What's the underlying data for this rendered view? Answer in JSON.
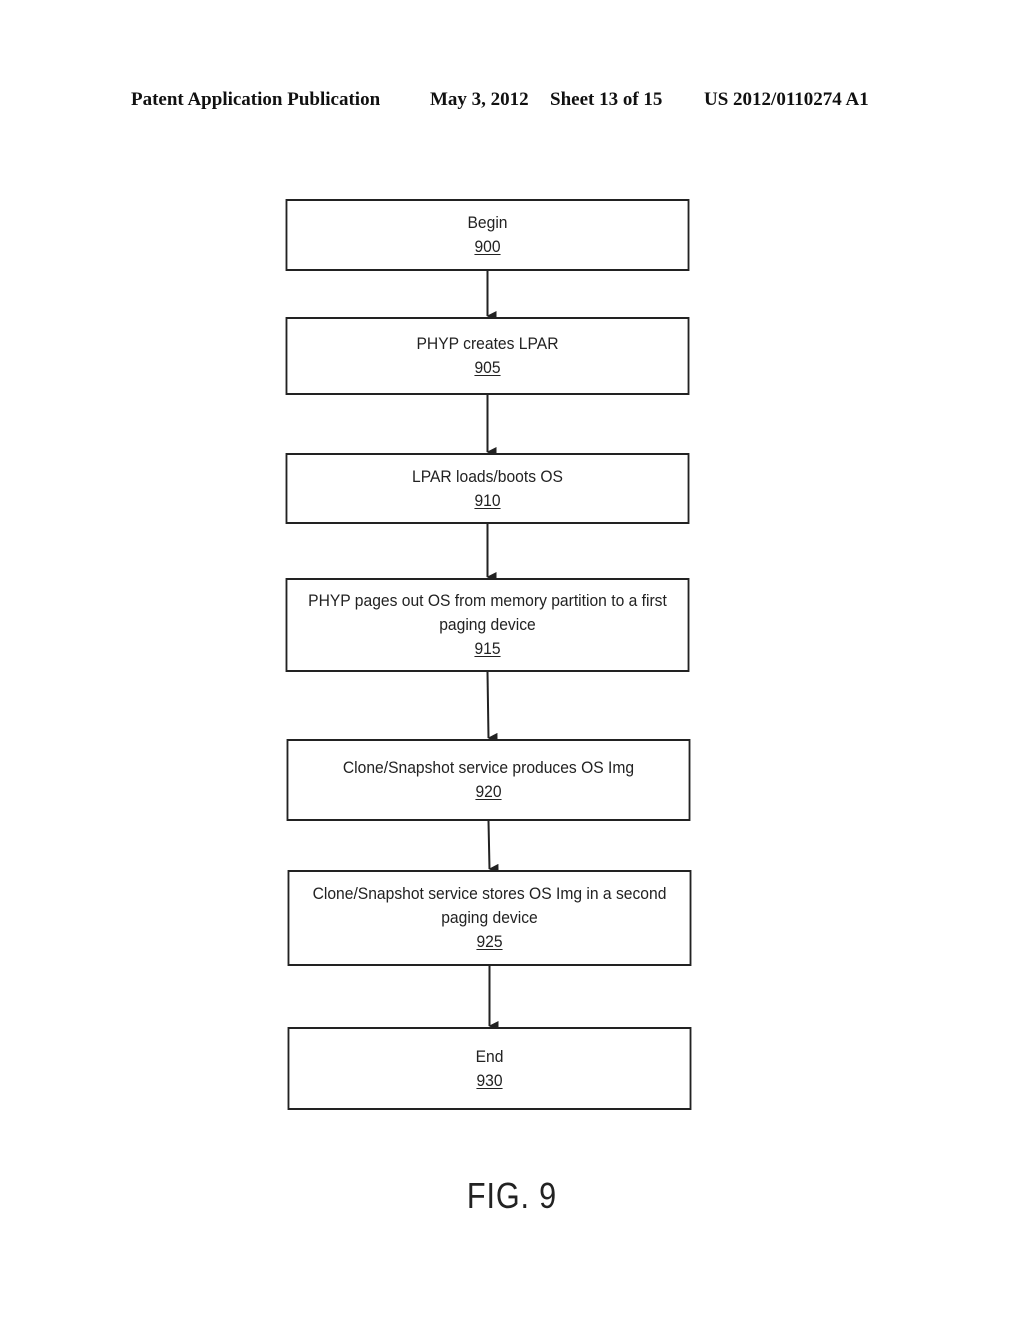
{
  "header": {
    "publication": "Patent Application Publication",
    "date": "May 3, 2012",
    "sheet": "Sheet 13 of 15",
    "number": "US 2012/0110274 A1"
  },
  "flow": {
    "steps": [
      {
        "label": "Begin",
        "ref": "900"
      },
      {
        "label": "PHYP creates LPAR",
        "ref": "905"
      },
      {
        "label": "LPAR loads/boots OS",
        "ref": "910"
      },
      {
        "label": "PHYP pages out OS from memory partition to a first paging device",
        "ref": "915"
      },
      {
        "label": "Clone/Snapshot service produces OS Img",
        "ref": "920"
      },
      {
        "label": "Clone/Snapshot service stores OS Img in a second paging device",
        "ref": "925"
      },
      {
        "label": "End",
        "ref": "930"
      }
    ],
    "edges": [
      [
        0,
        1
      ],
      [
        1,
        2
      ],
      [
        2,
        3
      ],
      [
        3,
        4
      ],
      [
        4,
        5
      ],
      [
        5,
        6
      ]
    ]
  },
  "figure": {
    "caption": "FIG. 9"
  }
}
